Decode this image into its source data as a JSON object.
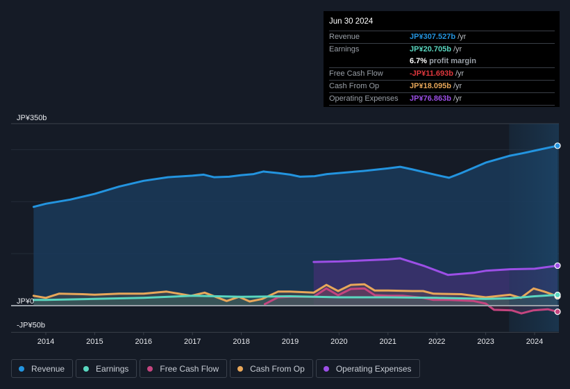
{
  "tooltip": {
    "date": "Jun 30 2024",
    "rows": [
      {
        "label": "Revenue",
        "value": "JP¥307.527b",
        "unit": "/yr",
        "color": "#2394df"
      },
      {
        "label": "Earnings",
        "value": "JP¥20.705b",
        "unit": "/yr",
        "color": "#5ad7c0"
      },
      {
        "label": "",
        "value": "6.7%",
        "unit": "profit margin",
        "color": "#ffffff"
      },
      {
        "label": "Free Cash Flow",
        "value": "-JP¥11.693b",
        "unit": "/yr",
        "color": "#e0383e"
      },
      {
        "label": "Cash From Op",
        "value": "JP¥18.095b",
        "unit": "/yr",
        "color": "#e8a75a"
      },
      {
        "label": "Operating Expenses",
        "value": "JP¥76.863b",
        "unit": "/yr",
        "color": "#9c4fe6"
      }
    ]
  },
  "legend": [
    {
      "label": "Revenue",
      "color": "#2394df"
    },
    {
      "label": "Earnings",
      "color": "#5ad7c0"
    },
    {
      "label": "Free Cash Flow",
      "color": "#c4457f"
    },
    {
      "label": "Cash From Op",
      "color": "#e8a75a"
    },
    {
      "label": "Operating Expenses",
      "color": "#9c4fe6"
    }
  ],
  "chart_data": {
    "type": "area",
    "title": "",
    "xlabel": "",
    "ylabel": "",
    "ylim": [
      -50,
      350
    ],
    "y_ticks": [
      {
        "value": 350,
        "label": "JP¥350b"
      },
      {
        "value": 0,
        "label": "JP¥0"
      },
      {
        "value": -50,
        "label": "-JP¥50b"
      }
    ],
    "y_gridlines": [
      350,
      300,
      200,
      100,
      0
    ],
    "x_ticks": [
      "2014",
      "2015",
      "2016",
      "2017",
      "2018",
      "2019",
      "2020",
      "2021",
      "2022",
      "2023",
      "2024"
    ],
    "xlim": [
      2013.0,
      2024.85
    ],
    "highlight_range": [
      2023.48,
      2024.5
    ],
    "unit": "JP¥ billions",
    "series": [
      {
        "name": "Revenue",
        "color": "#2394df",
        "fill": true,
        "x": [
          2013.75,
          2014.0,
          2014.5,
          2015.0,
          2015.5,
          2016.0,
          2016.5,
          2017.0,
          2017.23,
          2017.44,
          2017.75,
          2018.0,
          2018.25,
          2018.45,
          2018.75,
          2019.0,
          2019.2,
          2019.5,
          2019.75,
          2020.0,
          2020.5,
          2021.0,
          2021.25,
          2021.5,
          2022.0,
          2022.25,
          2022.5,
          2023.0,
          2023.48,
          2023.75,
          2024.0,
          2024.47
        ],
        "values": [
          190,
          196,
          204,
          215,
          229,
          240,
          247,
          250,
          252,
          247,
          248,
          251,
          253,
          258,
          255,
          252,
          248,
          249,
          253,
          255,
          259,
          264,
          267,
          262,
          251,
          246,
          255,
          275,
          288,
          293,
          298,
          307.5
        ]
      },
      {
        "name": "Earnings",
        "color": "#5ad7c0",
        "fill": true,
        "x": [
          2013.75,
          2014.0,
          2015.0,
          2016.0,
          2017.0,
          2018.0,
          2019.0,
          2020.0,
          2021.0,
          2022.0,
          2023.0,
          2023.5,
          2024.0,
          2024.47
        ],
        "values": [
          11,
          11,
          13,
          15,
          19,
          17,
          18,
          16,
          16,
          15,
          13,
          14,
          18,
          20.7
        ]
      },
      {
        "name": "Free Cash Flow",
        "color": "#c4457f",
        "fill": true,
        "x": [
          2018.48,
          2018.75,
          2019.0,
          2019.48,
          2019.74,
          2019.98,
          2020.24,
          2020.52,
          2020.73,
          2021.0,
          2021.3,
          2021.72,
          2021.93,
          2022.25,
          2022.75,
          2023.0,
          2023.17,
          2023.53,
          2023.73,
          2023.98,
          2024.27,
          2024.47
        ],
        "values": [
          3,
          16,
          17,
          17,
          33,
          20,
          32,
          33,
          20,
          19,
          19,
          15,
          11,
          11,
          9,
          4,
          -8,
          -9,
          -15,
          -9,
          -7,
          -11.7
        ]
      },
      {
        "name": "Cash From Op",
        "color": "#e8a75a",
        "fill": true,
        "x": [
          2013.75,
          2014.0,
          2014.27,
          2014.75,
          2015.0,
          2015.5,
          2016.0,
          2016.47,
          2016.97,
          2017.25,
          2017.7,
          2017.95,
          2018.17,
          2018.43,
          2018.75,
          2019.0,
          2019.48,
          2019.74,
          2019.98,
          2020.24,
          2020.52,
          2020.73,
          2021.0,
          2021.5,
          2021.72,
          2021.93,
          2022.5,
          2023.0,
          2023.5,
          2023.72,
          2023.98,
          2024.2,
          2024.47
        ],
        "values": [
          19,
          15,
          23,
          22,
          21,
          23,
          23,
          27,
          19,
          25,
          9,
          17,
          8,
          13,
          27,
          27,
          25,
          40,
          28,
          40,
          41,
          29,
          29,
          28,
          28,
          23,
          22,
          16,
          21,
          15,
          33,
          27,
          18.1
        ]
      },
      {
        "name": "Operating Expenses",
        "color": "#9c4fe6",
        "fill": true,
        "x": [
          2019.48,
          2020.0,
          2020.5,
          2021.0,
          2021.25,
          2021.75,
          2022.23,
          2022.75,
          2023.0,
          2023.5,
          2024.0,
          2024.47
        ],
        "values": [
          84,
          85,
          87,
          89,
          91,
          76,
          59,
          63,
          67,
          70,
          71,
          76.9
        ]
      }
    ]
  }
}
